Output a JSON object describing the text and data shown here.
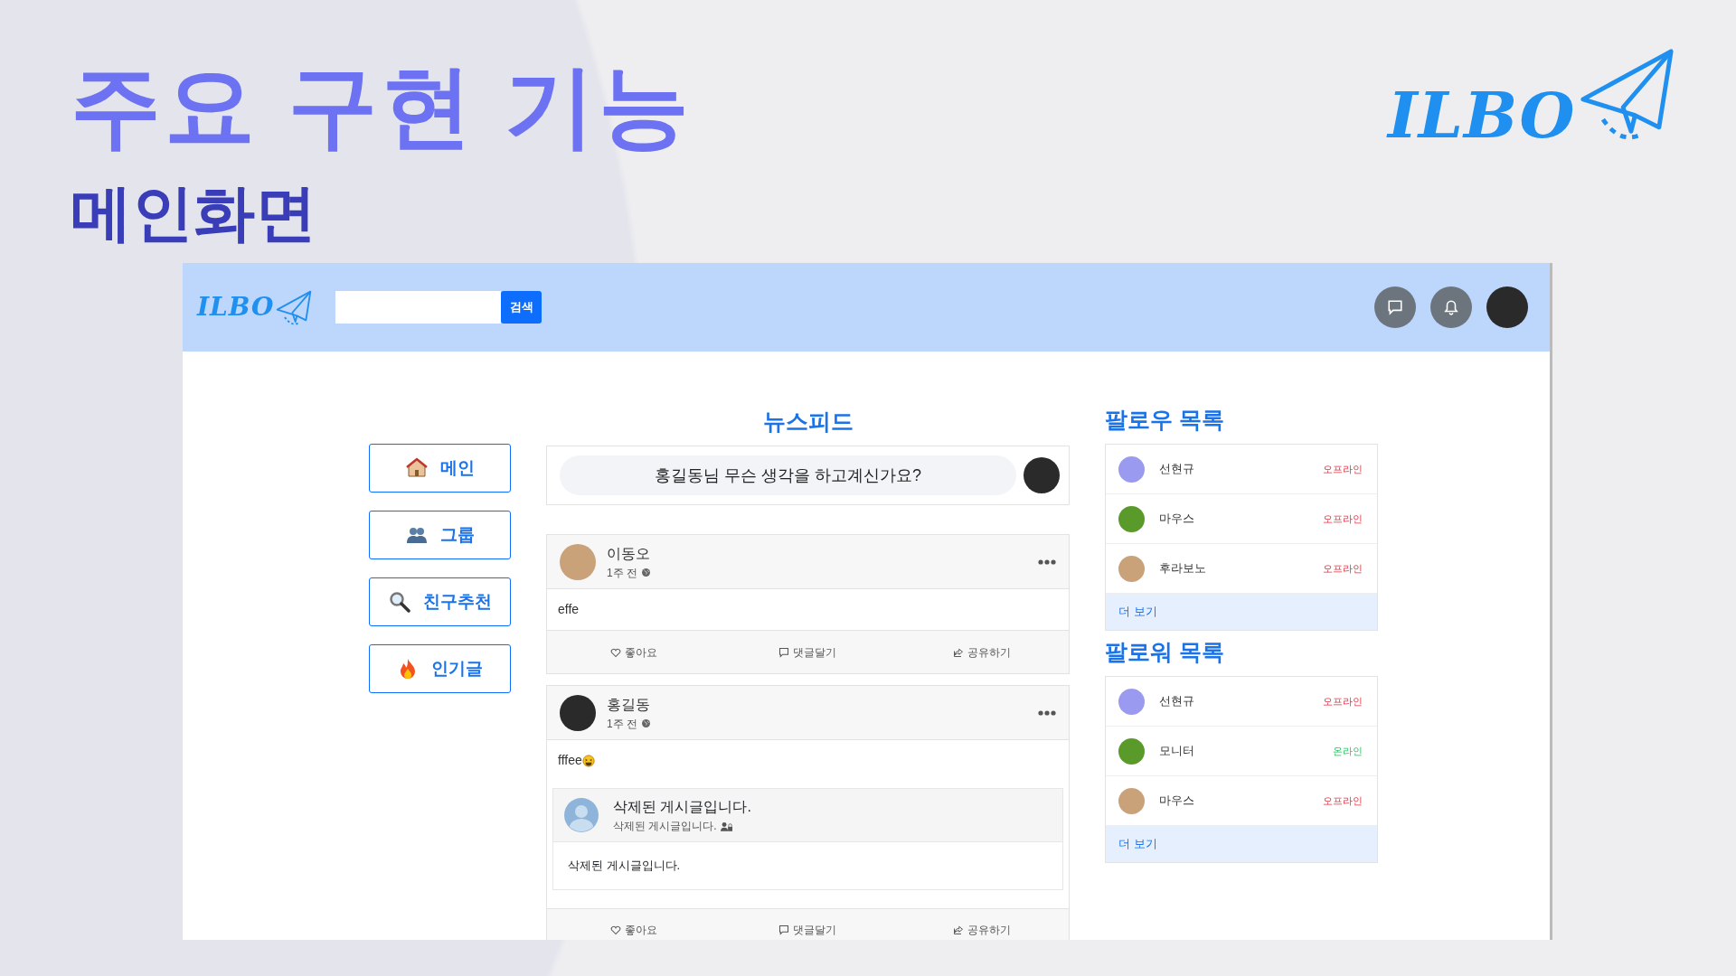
{
  "slide": {
    "title": "주요 구현 기능",
    "subtitle": "메인화면",
    "logo": "ILBO"
  },
  "navbar": {
    "logo": "ILBO",
    "search_button": "검색"
  },
  "sidebar": {
    "items": [
      {
        "label": "메인"
      },
      {
        "label": "그룹"
      },
      {
        "label": "친구추천"
      },
      {
        "label": "인기글"
      }
    ]
  },
  "feed": {
    "title": "뉴스피드",
    "composer": {
      "placeholder": "홍길동님 무슨 생각을 하고계신가요?"
    },
    "posts": [
      {
        "author": "이동오",
        "time": "1주 전",
        "body": "effe",
        "actions": [
          "좋아요",
          "댓글달기",
          "공유하기"
        ]
      },
      {
        "author": "홍길동",
        "time": "1주 전",
        "body": "fffee",
        "shared": {
          "title": "삭제된 게시글입니다.",
          "subtitle": "삭제된 게시글입니다.",
          "body": "삭제된 게시글입니다."
        },
        "actions": [
          "좋아요",
          "댓글달기",
          "공유하기"
        ]
      }
    ]
  },
  "lists": [
    {
      "title": "팔로우 목록",
      "users": [
        {
          "name": "선현규",
          "status": "오프라인",
          "online": false
        },
        {
          "name": "마우스",
          "status": "오프라인",
          "online": false
        },
        {
          "name": "후라보노",
          "status": "오프라인",
          "online": false
        }
      ],
      "more": "더 보기"
    },
    {
      "title": "팔로워 목록",
      "users": [
        {
          "name": "선현규",
          "status": "오프라인",
          "online": false
        },
        {
          "name": "모니터",
          "status": "온라인",
          "online": true
        },
        {
          "name": "마우스",
          "status": "오프라인",
          "online": false
        }
      ],
      "more": "더 보기"
    }
  ]
}
